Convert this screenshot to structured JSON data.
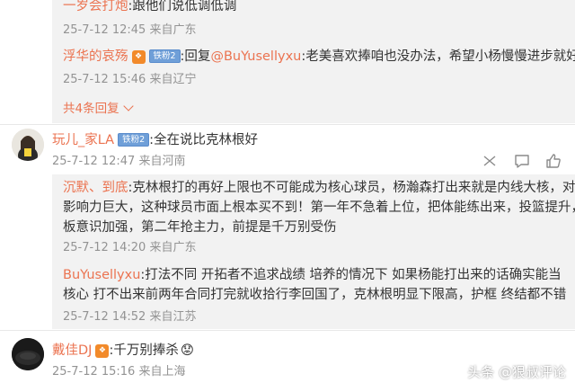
{
  "box1": {
    "reply1": {
      "name": "一岁会打炮",
      "text": ":跟他们说低调低调",
      "meta": "25-7-12 12:45 来自广东"
    },
    "reply2": {
      "name": "浮华的哀殇",
      "badge": "铁粉2",
      "text": ":回复",
      "mention": "@BuYusellyxu",
      "rest": ":老美喜欢捧咱也没办法，希望小杨慢慢进步就好",
      "meta": "25-7-12 15:46 来自辽宁"
    },
    "more": "共4条回复"
  },
  "comment2": {
    "name": "玩儿_家LA",
    "badge": "铁粉2",
    "text": ":全在说比克林根好",
    "meta": "25-7-12 12:47 来自河南",
    "replies": {
      "r1": {
        "name": "沉默、到底",
        "line1": ":克林根打的再好上限也不可能成为核心球员，杨瀚森打出来就是内线大核，对比赛",
        "line2": "影响力巨大，这种球员市面上根本买不到！第一年不急着上位，把体能练出来，投篮提升，篮",
        "line3": "板意识加强，第二年抢主力，前提是千万别受伤",
        "meta": "25-7-12 14:20 来自广东"
      },
      "r2": {
        "name": "BuYusellyxu",
        "line1": ":打法不同 开拓者不追求战绩 培养的情况下 如果杨能打出来的话确实能当",
        "line2": "核心 打不出来前两年合同打完就收拾行李回国了，克林根明显下限高，护框 终结都不错",
        "meta": "25-7-12 14:52 来自江苏"
      }
    }
  },
  "comment3": {
    "name": "戴佳DJ",
    "text": ":千万别捧杀",
    "emoji": "😟",
    "meta": "25-7-12 15:16 来自上海"
  },
  "watermark": "头条 @狠叔评论",
  "icons": [
    "share-icon",
    "comment-icon",
    "like-icon",
    "verified-fan-badge",
    "avatar"
  ],
  "colors": {
    "name": "#eb7350",
    "meta": "#939393",
    "reply_bg": "#f2f2f2",
    "badge": "#6f9fd8"
  }
}
